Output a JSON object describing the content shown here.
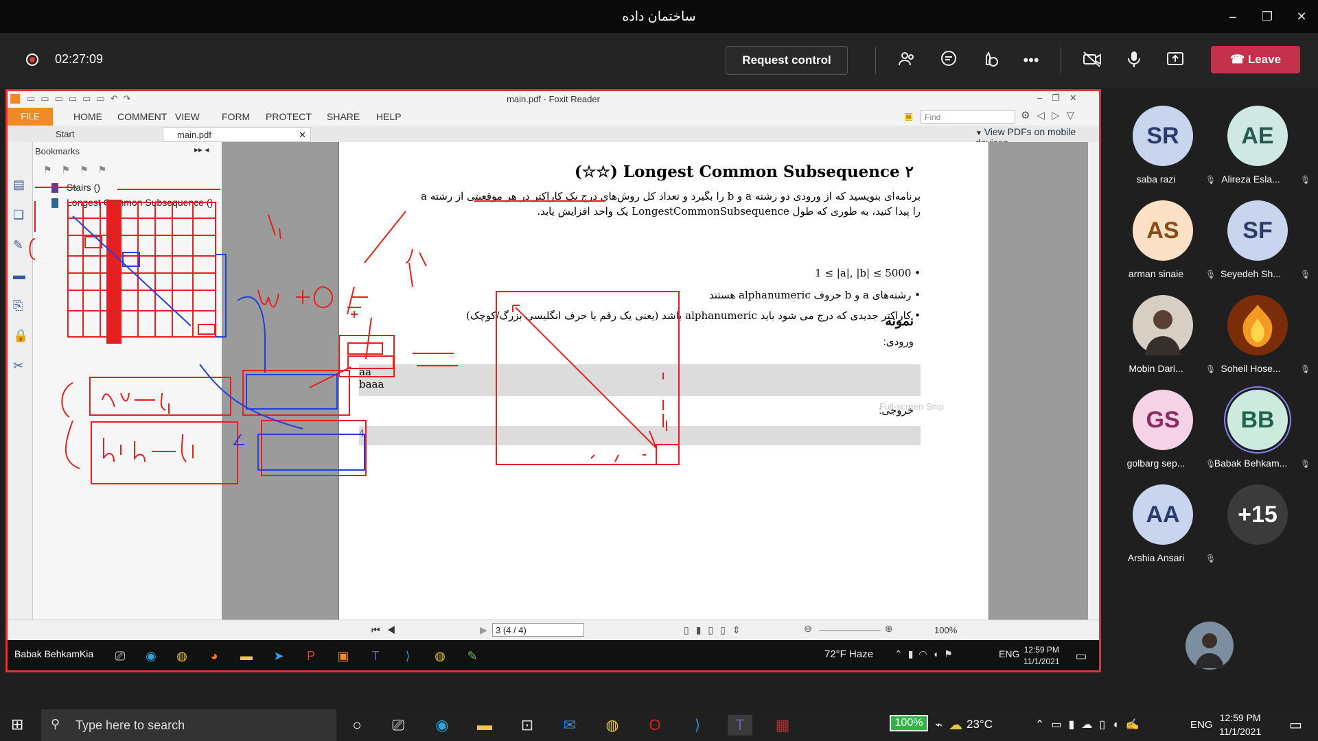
{
  "window": {
    "title": "ساختمان داده",
    "minimize": "–",
    "restore": "❐",
    "close": "✕"
  },
  "meeting": {
    "timer": "02:27:09",
    "request_control": "Request control",
    "leave": "Leave",
    "icons": [
      "participants-icon",
      "chat-icon",
      "reactions-icon",
      "more-icon",
      "camera-off-icon",
      "mic-icon",
      "share-icon"
    ]
  },
  "foxit": {
    "title": "main.pdf - Foxit Reader",
    "file_tab": "FILE",
    "tabs": [
      "HOME",
      "COMMENT",
      "VIEW",
      "FORM",
      "PROTECT",
      "SHARE",
      "HELP"
    ],
    "find_placeholder": "Find",
    "doc_tabs": [
      "Start",
      "main.pdf"
    ],
    "mobile_link": "View PDFs on mobile devices",
    "bookmarks_title": "Bookmarks",
    "bookmarks": [
      "Stairs ()",
      "Longest Common Subsequence ()"
    ],
    "page_input": "3 (4 / 4)",
    "zoom": "100%"
  },
  "document": {
    "heading": "(☆☆) Longest Common Subsequence  ۲",
    "para": "برنامه‌ای بنویسید که از ورودی دو رشته a و b را بگیرد و تعداد کل روش‌های درج یک کاراکتر در هر موقعیتی از رشته a را پیدا کنید، به طوری که طول LongestCommonSubsequence یک واحد افزایش یابد.",
    "bullets": [
      "1 ≤ |a|, |b| ≤ 5000",
      "رشته‌های a و b حروف alphanumeric هستند",
      "کاراکتر جدیدی که درج می شود باید alphanumeric باشد (یعنی یک رقم یا حرف انگلیسی بزرگ/کوچک)"
    ],
    "example_title": "نمونه",
    "input_label": "ورودی:",
    "output_label": "خروجی:",
    "input_lines": [
      "aa",
      "baaa"
    ],
    "output_value": "4",
    "snip_hint": "Full-screen Snip"
  },
  "inner_taskbar": {
    "presenter": "Babak BehkamKia",
    "weather": "72°F  Haze",
    "lang": "ENG",
    "time": "12:59 PM",
    "date": "11/1/2021"
  },
  "participants": [
    {
      "initials": "SR",
      "name": "saba razi",
      "bg": "#c9d5ef",
      "fg": "#2b3c6b"
    },
    {
      "initials": "AE",
      "name": "Alireza Esla...",
      "bg": "#cfe8e4",
      "fg": "#245a52"
    },
    {
      "initials": "AS",
      "name": "arman sinaie",
      "bg": "#fde1c7",
      "fg": "#8a4a12"
    },
    {
      "initials": "SF",
      "name": "Seyedeh Sh...",
      "bg": "#c9d5ef",
      "fg": "#2b3c6b"
    },
    {
      "initials": "",
      "name": "Mobin Dari...",
      "bg": "#d8cfc4",
      "fg": "#333"
    },
    {
      "initials": "",
      "name": "Soheil Hose...",
      "bg": "#7a2d08",
      "fg": "#fff"
    },
    {
      "initials": "GS",
      "name": "golbarg sep...",
      "bg": "#f6d2e6",
      "fg": "#8d2a61"
    },
    {
      "initials": "BB",
      "name": "Babak Behkam...",
      "bg": "#cdeadf",
      "fg": "#21644e"
    },
    {
      "initials": "AA",
      "name": "Arshia Ansari",
      "bg": "#c9d5ef",
      "fg": "#2b3c6b"
    },
    {
      "initials": "+15",
      "name": "",
      "bg": "#3b3b3b",
      "fg": "#fff"
    }
  ],
  "taskbar": {
    "search": "Type here to search",
    "battery": "100%",
    "temp": "23°C",
    "lang": "ENG",
    "time": "12:59 PM",
    "date": "11/1/2021"
  }
}
